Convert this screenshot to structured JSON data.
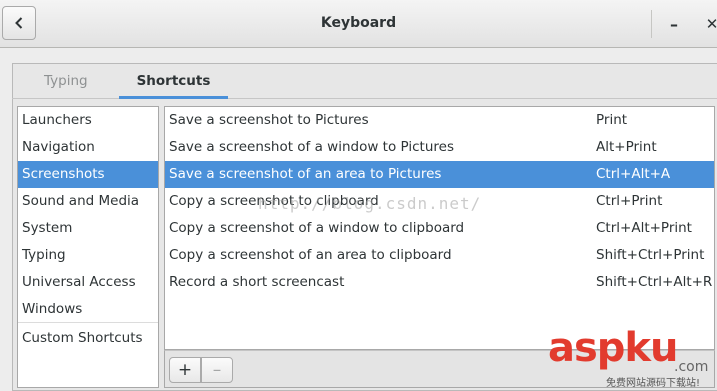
{
  "window": {
    "title": "Keyboard",
    "minimize_label": "–",
    "close_label": "✕"
  },
  "tabs": [
    {
      "label": "Typing",
      "active": false
    },
    {
      "label": "Shortcuts",
      "active": true
    }
  ],
  "sections": [
    {
      "label": "Launchers"
    },
    {
      "label": "Navigation"
    },
    {
      "label": "Screenshots",
      "selected": true
    },
    {
      "label": "Sound and Media"
    },
    {
      "label": "System"
    },
    {
      "label": "Typing"
    },
    {
      "label": "Universal Access"
    },
    {
      "label": "Windows"
    },
    {
      "label": "Custom Shortcuts"
    }
  ],
  "shortcuts": [
    {
      "name": "Save a screenshot to Pictures",
      "accel": "Print"
    },
    {
      "name": "Save a screenshot of a window to Pictures",
      "accel": "Alt+Print"
    },
    {
      "name": "Save a screenshot of an area to Pictures",
      "accel": "Ctrl+Alt+A",
      "selected": true
    },
    {
      "name": "Copy a screenshot to clipboard",
      "accel": "Ctrl+Print"
    },
    {
      "name": "Copy a screenshot of a window to clipboard",
      "accel": "Ctrl+Alt+Print"
    },
    {
      "name": "Copy a screenshot of an area to clipboard",
      "accel": "Shift+Ctrl+Print"
    },
    {
      "name": "Record a short screencast",
      "accel": "Shift+Ctrl+Alt+R"
    }
  ],
  "toolbar": {
    "add_label": "+",
    "remove_label": "–"
  },
  "watermark": {
    "url": "http://blog.csdn.net/",
    "logo": "aspku",
    "logo_suffix": ".com",
    "logo_sub": "免费网站源码下载站!"
  },
  "colors": {
    "accent": "#4a90d9",
    "watermark_logo": "#e23b2e"
  }
}
